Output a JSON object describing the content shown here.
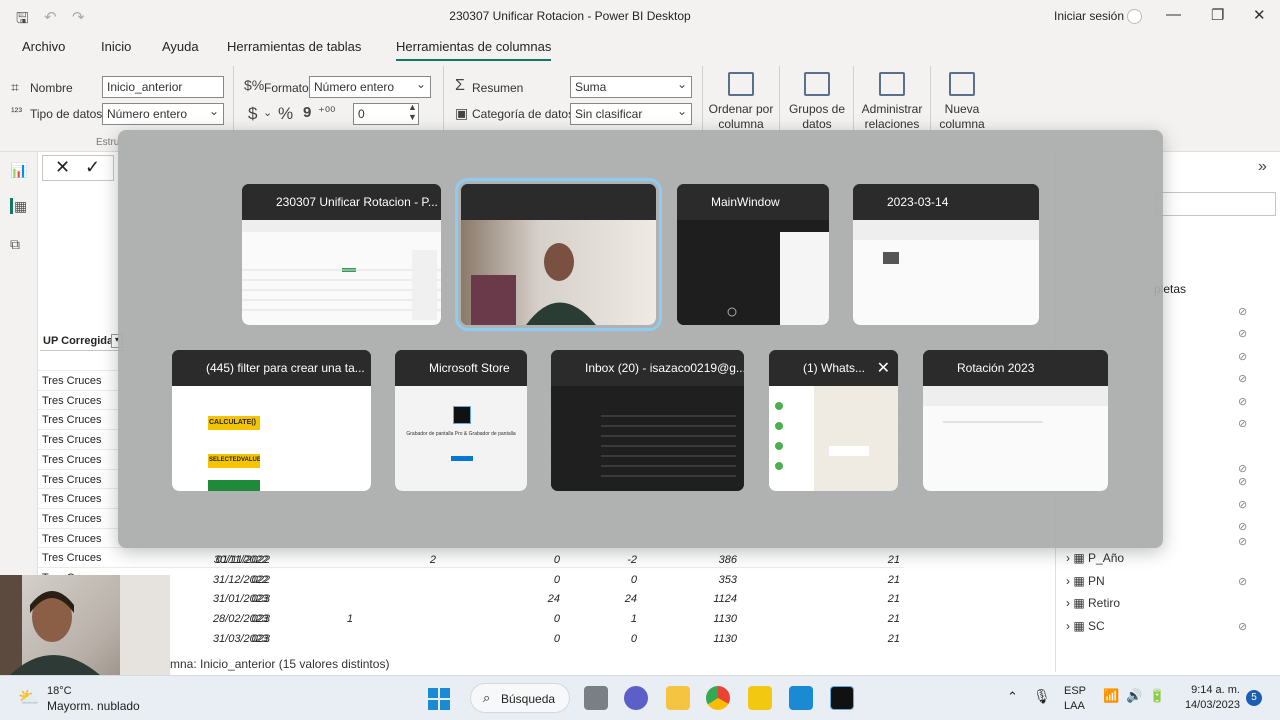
{
  "titlebar": {
    "title": "230307 Unificar Rotacion - Power BI Desktop",
    "signin": "Iniciar sesión"
  },
  "ribbon_tabs": [
    "Archivo",
    "Inicio",
    "Ayuda",
    "Herramientas de tablas",
    "Herramientas de columnas"
  ],
  "ribbon": {
    "name_label": "Nombre",
    "name_value": "Inicio_anterior",
    "datatype_label": "Tipo de datos",
    "datatype_value": "Número entero",
    "format_label": "Formato",
    "format_value": "Número entero",
    "decimals_value": "0",
    "currency_symbol": "$",
    "percent_symbol": "%",
    "comma_symbol": "9",
    "summary_label": "Resumen",
    "summary_value": "Suma",
    "category_label": "Categoría de datos",
    "category_value": "Sin clasificar",
    "structure_label": "Estru",
    "sort_by_column": "Ordenar por columna",
    "data_groups": "Grupos de datos",
    "manage_relations": "Administrar relaciones",
    "new_column": "Nueva columna"
  },
  "table": {
    "column_header": "UP Corregida",
    "rows_left": [
      "Tres Cruces",
      "Tres Cruces",
      "Tres Cruces",
      "Tres Cruces",
      "Tres Cruces",
      "Tres Cruces",
      "Tres Cruces",
      "Tres Cruces",
      "Tres Cruces",
      "Tres Cruces",
      "Tres Cruces"
    ],
    "bottom_rows": [
      {
        "c1": "01/11/2022",
        "c2": "30/11/2022",
        "c3": "",
        "c4": "2",
        "c5": "0",
        "c6": "-2",
        "c7": "386",
        "c8": "21"
      },
      {
        "c1": "022",
        "c2": "31/12/2022",
        "c3": "",
        "c4": "",
        "c5": "0",
        "c6": "0",
        "c7": "353",
        "c8": "21"
      },
      {
        "c1": "023",
        "c2": "31/01/2023",
        "c3": "",
        "c4": "",
        "c5": "24",
        "c6": "24",
        "c7": "1124",
        "c8": "21"
      },
      {
        "c1": "023",
        "c2": "28/02/2023",
        "c3": "1",
        "c4": "",
        "c5": "0",
        "c6": "1",
        "c7": "1130",
        "c8": "21"
      },
      {
        "c1": "023",
        "c2": "31/03/2023",
        "c3": "",
        "c4": "",
        "c5": "0",
        "c6": "0",
        "c7": "1130",
        "c8": "21"
      }
    ],
    "status": "mna: Inicio_anterior (15 valores distintos)"
  },
  "right_pane": {
    "partial_text": "pletas",
    "fields": [
      "P_Año",
      "PN",
      "Retiro",
      "SC"
    ]
  },
  "switcher": {
    "windows_row1": [
      {
        "title": "230307 Unificar Rotacion - P...",
        "icon": "powerbi-icon"
      },
      {
        "title": "",
        "icon": "recorder-icon"
      },
      {
        "title": "MainWindow",
        "icon": "recorder-icon"
      },
      {
        "title": "2023-03-14",
        "icon": "folder-icon"
      }
    ],
    "windows_row2": [
      {
        "title": "(445) filter para crear una ta...",
        "icon": "chrome-icon"
      },
      {
        "title": "Microsoft Store",
        "icon": "store-icon"
      },
      {
        "title": "Inbox (20) - isazaco0219@g...",
        "icon": "chrome-icon"
      },
      {
        "title": "(1) Whats...",
        "icon": "chrome-icon"
      },
      {
        "title": "Rotación 2023",
        "icon": "folder-icon"
      }
    ],
    "thumb_text": {
      "calculate": "CALCULATE()",
      "selectedvalue": "SELECTEDVALUE",
      "store_app": "Grabador de pantalla Pro & Grabador de pantalla"
    }
  },
  "taskbar": {
    "temperature": "18°C",
    "weather": "Mayorm. nublado",
    "search": "Búsqueda",
    "lang1": "ESP",
    "lang2": "LAA",
    "time": "9:14 a. m.",
    "date": "14/03/2023",
    "notif_count": "5"
  },
  "colors": {
    "accent": "#117865",
    "switcher_bg": "#aaacac",
    "selected_outline": "#8ecbf1"
  }
}
